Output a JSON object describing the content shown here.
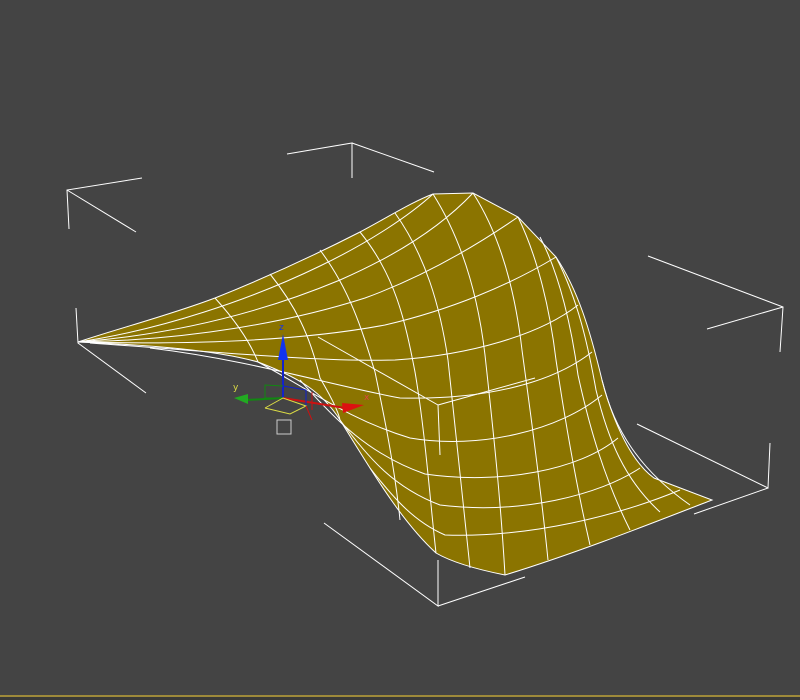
{
  "viewport": {
    "background": "#444444",
    "bracket_color": "#ffffff",
    "mesh_fill": "#8b7400",
    "mesh_wire": "#ffffff"
  },
  "gizmo": {
    "x_label": "x",
    "y_label": "y",
    "z_label": "z",
    "x_color": "#cc1111",
    "y_color": "#118811",
    "z_color": "#1122cc"
  },
  "status_bar": {
    "accent": "#9e8a3a"
  }
}
